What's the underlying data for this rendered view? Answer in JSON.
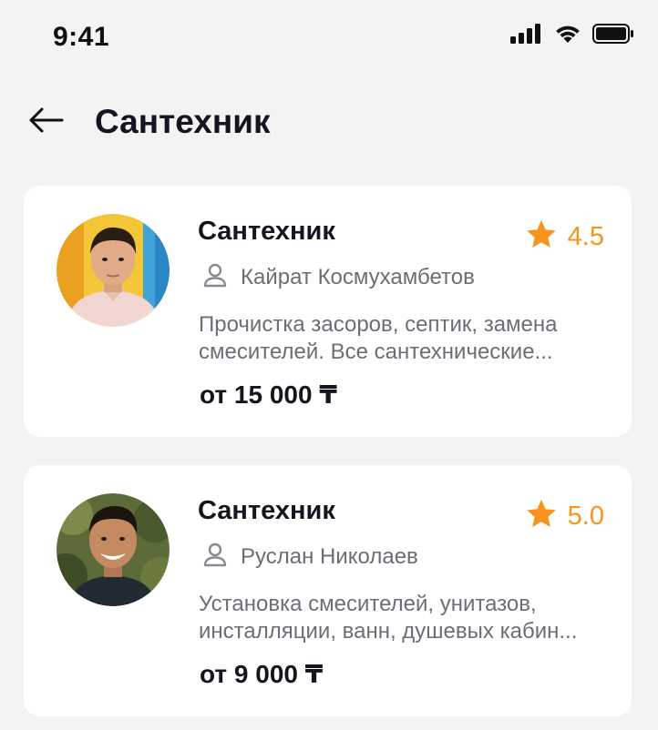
{
  "status_bar": {
    "time": "9:41",
    "icons": [
      "cellular-signal-icon",
      "wifi-icon",
      "battery-icon"
    ]
  },
  "header": {
    "back_icon": "arrow-left-icon",
    "title": "Сантехник"
  },
  "colors": {
    "background": "#f3f3f4",
    "card": "#ffffff",
    "accent_rating": "#f7931e",
    "secondary_text": "#6d6d76",
    "primary_text": "#15151f"
  },
  "listings": [
    {
      "title": "Сантехник",
      "rating": "4.5",
      "person_icon": "user-icon",
      "name": "Кайрат Космухамбетов",
      "description_lines": [
        "Прочистка засоров, септик, замена",
        "смесителей. Все сантехнические..."
      ],
      "price": "от 15 000 ₸"
    },
    {
      "title": "Сантехник",
      "rating": "5.0",
      "person_icon": "user-icon",
      "name": "Руслан Николаев",
      "description_lines": [
        "Установка смесителей, унитазов,",
        "инсталляции, ванн, душевых кабин..."
      ],
      "price": "от 9 000 ₸"
    }
  ]
}
